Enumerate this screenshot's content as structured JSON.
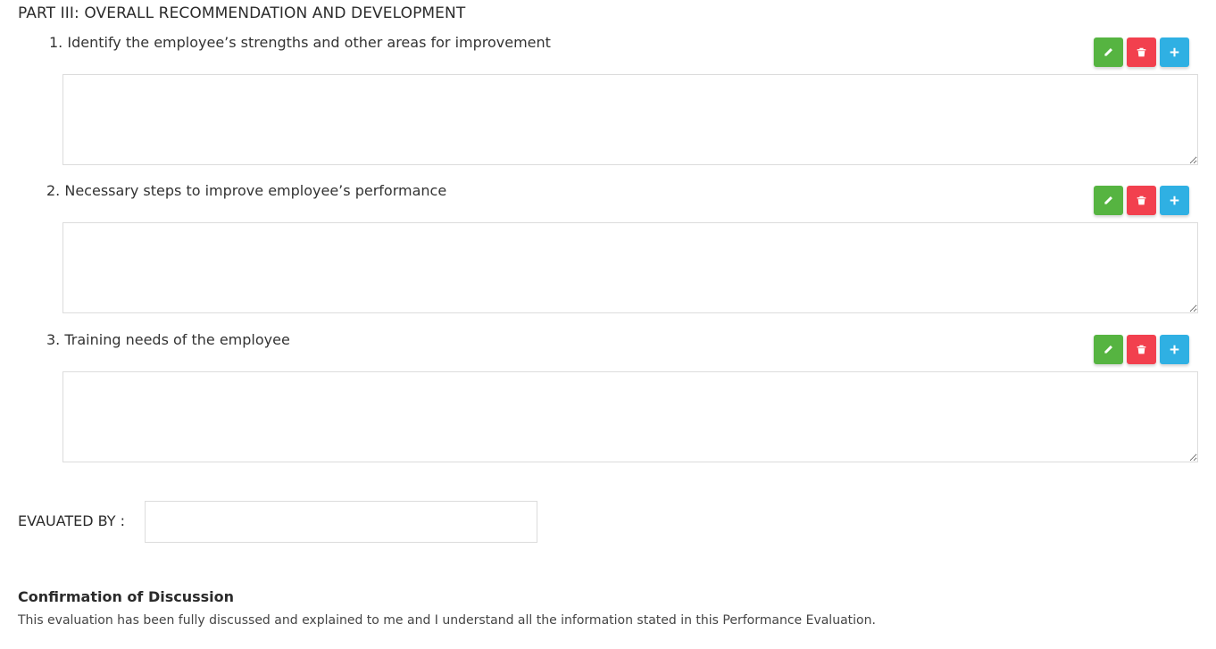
{
  "part_title": "PART III: OVERALL RECOMMENDATION AND DEVELOPMENT",
  "questions": [
    {
      "number": "1.",
      "text": "Identify the employee’s strengths and other areas for improvement",
      "value": ""
    },
    {
      "number": "2.",
      "text": "Necessary steps to improve employee’s performance",
      "value": ""
    },
    {
      "number": "3.",
      "text": "Training needs of the employee",
      "value": ""
    }
  ],
  "actions": {
    "edit_icon": "pencil-icon",
    "delete_icon": "trash-icon",
    "add_icon": "plus-icon"
  },
  "colors": {
    "edit": "#56b441",
    "delete": "#f2404e",
    "add": "#2fb0e3"
  },
  "evaluated_by": {
    "label": "EVAUATED BY :",
    "value": ""
  },
  "confirmation": {
    "title": "Confirmation of Discussion",
    "text": "This evaluation has been fully discussed and explained to me and I understand all the information stated in this Performance Evaluation."
  }
}
